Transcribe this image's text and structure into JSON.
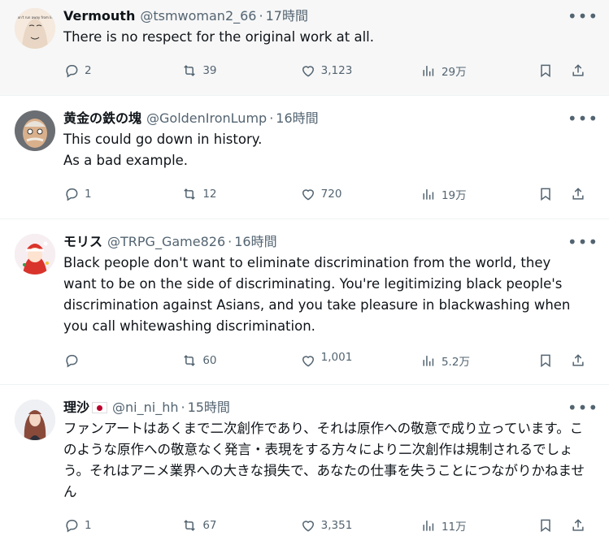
{
  "tweets": [
    {
      "name": "Vermouth",
      "flag": false,
      "handle": "@tsmwoman2_66",
      "sep": "·",
      "time": "17時間",
      "text": "There is no respect for the original work at all.",
      "replies": "2",
      "retweets": "39",
      "likes": "3,123",
      "views": "29万",
      "avatar_desc": "Don't run away from life"
    },
    {
      "name": "黄金の鉄の塊",
      "flag": false,
      "handle": "@GoldenIronLump",
      "sep": "·",
      "time": "16時間",
      "text": "This could go down in history.\nAs a bad example.",
      "replies": "1",
      "retweets": "12",
      "likes": "720",
      "views": "19万"
    },
    {
      "name": "モリス",
      "flag": false,
      "handle": "@TRPG_Game826",
      "sep": "·",
      "time": "16時間",
      "text": "Black people don't want to eliminate discrimination from the world, they want to be on the side of discriminating. You're legitimizing black people's discrimination against Asians, and you take pleasure in blackwashing when you call whitewashing discrimination.",
      "replies": "",
      "retweets": "60",
      "likes": "1,001",
      "views": "5.2万"
    },
    {
      "name": "理沙",
      "flag": true,
      "handle": "@ni_ni_hh",
      "sep": "·",
      "time": "15時間",
      "text": "ファンアートはあくまで二次創作であり、それは原作への敬意で成り立っています。このような原作への敬意なく発言・表現をする方々により二次創作は規制されるでしょう。それはアニメ業界への大きな損失で、あなたの仕事を失うことにつながりかねません",
      "replies": "1",
      "retweets": "67",
      "likes": "3,351",
      "views": "11万"
    }
  ],
  "icons": {
    "reply": "reply-icon",
    "retweet": "retweet-icon",
    "like": "heart-icon",
    "views": "views-icon",
    "bookmark": "bookmark-icon",
    "share": "share-icon",
    "more": "more-icon"
  },
  "colors": {
    "text": "#0f1419",
    "secondary": "#536471",
    "border": "#eff3f4",
    "highlight_bg": "#f7f7f7"
  }
}
